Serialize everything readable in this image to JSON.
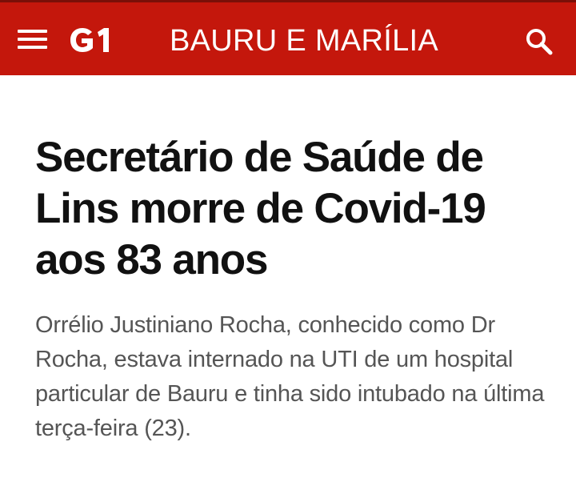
{
  "header": {
    "brand": "G1",
    "section_title": "BAURU E MARÍLIA",
    "brand_color": "#c4170c",
    "menu_icon": "hamburger-menu-icon",
    "search_icon": "search-icon"
  },
  "article": {
    "headline": "Secretário de Saúde de Lins morre de Covid-19 aos 83 anos",
    "subtitle": "Orrélio Justiniano Rocha, conhecido como Dr Rocha, estava internado na UTI de um hospital particular de Bauru e tinha sido intubado na última terça-feira (23)."
  }
}
